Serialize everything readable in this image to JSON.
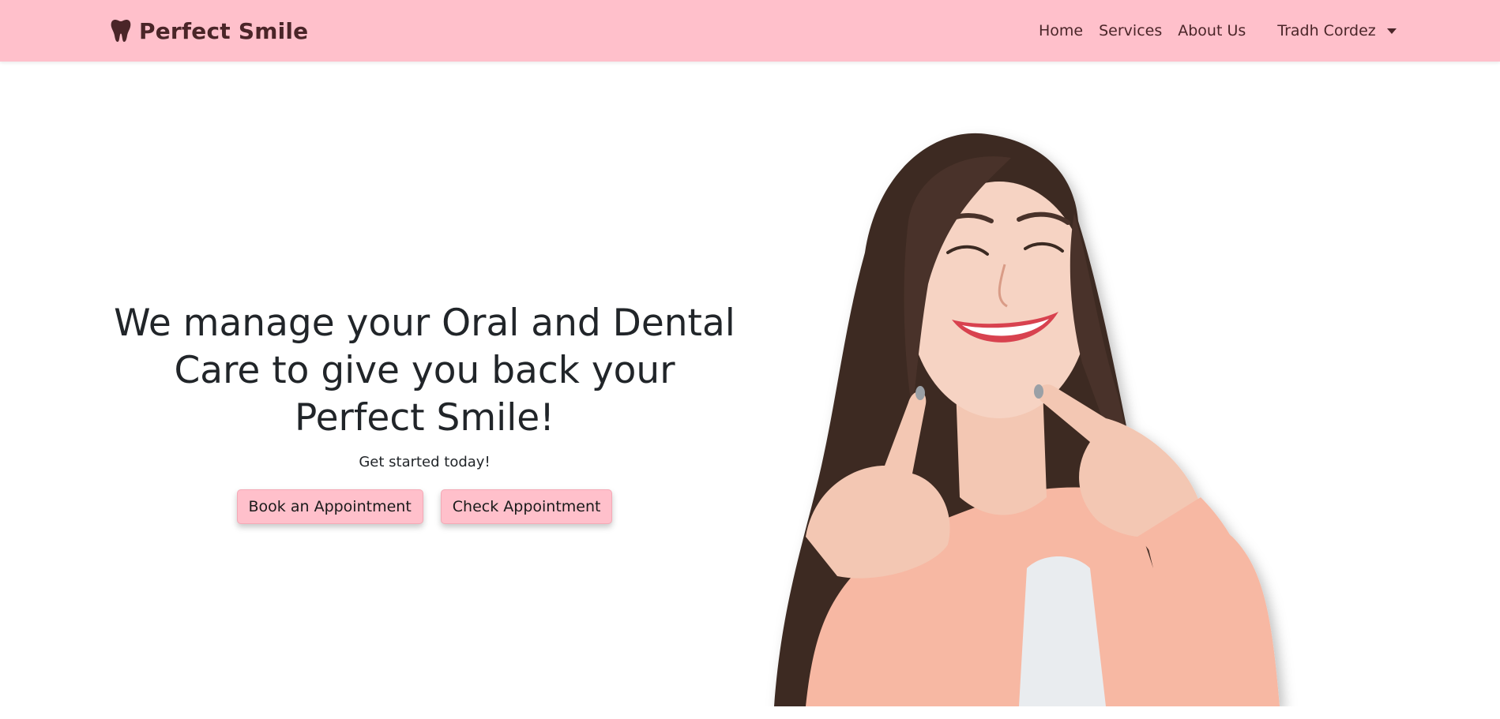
{
  "navbar": {
    "brand": {
      "icon": "tooth-icon",
      "name": "Perfect Smile"
    },
    "links": [
      {
        "label": "Home"
      },
      {
        "label": "Services"
      },
      {
        "label": "About Us"
      }
    ],
    "user": {
      "name": "Tradh Cordez",
      "icon": "caret-down-icon"
    }
  },
  "hero": {
    "title": "We manage your Oral and Dental Care to give you back your Perfect Smile!",
    "subtitle": "Get started today!",
    "buttons": {
      "book": "Book an Appointment",
      "check": "Check Appointment"
    },
    "image": {
      "subject": "smiling-woman-pointing-at-cheeks"
    }
  },
  "colors": {
    "navbar_bg": "#ffc0cb",
    "brand_text": "#4a2528",
    "button_bg": "#ffc0cb",
    "text_dark": "#212529"
  }
}
